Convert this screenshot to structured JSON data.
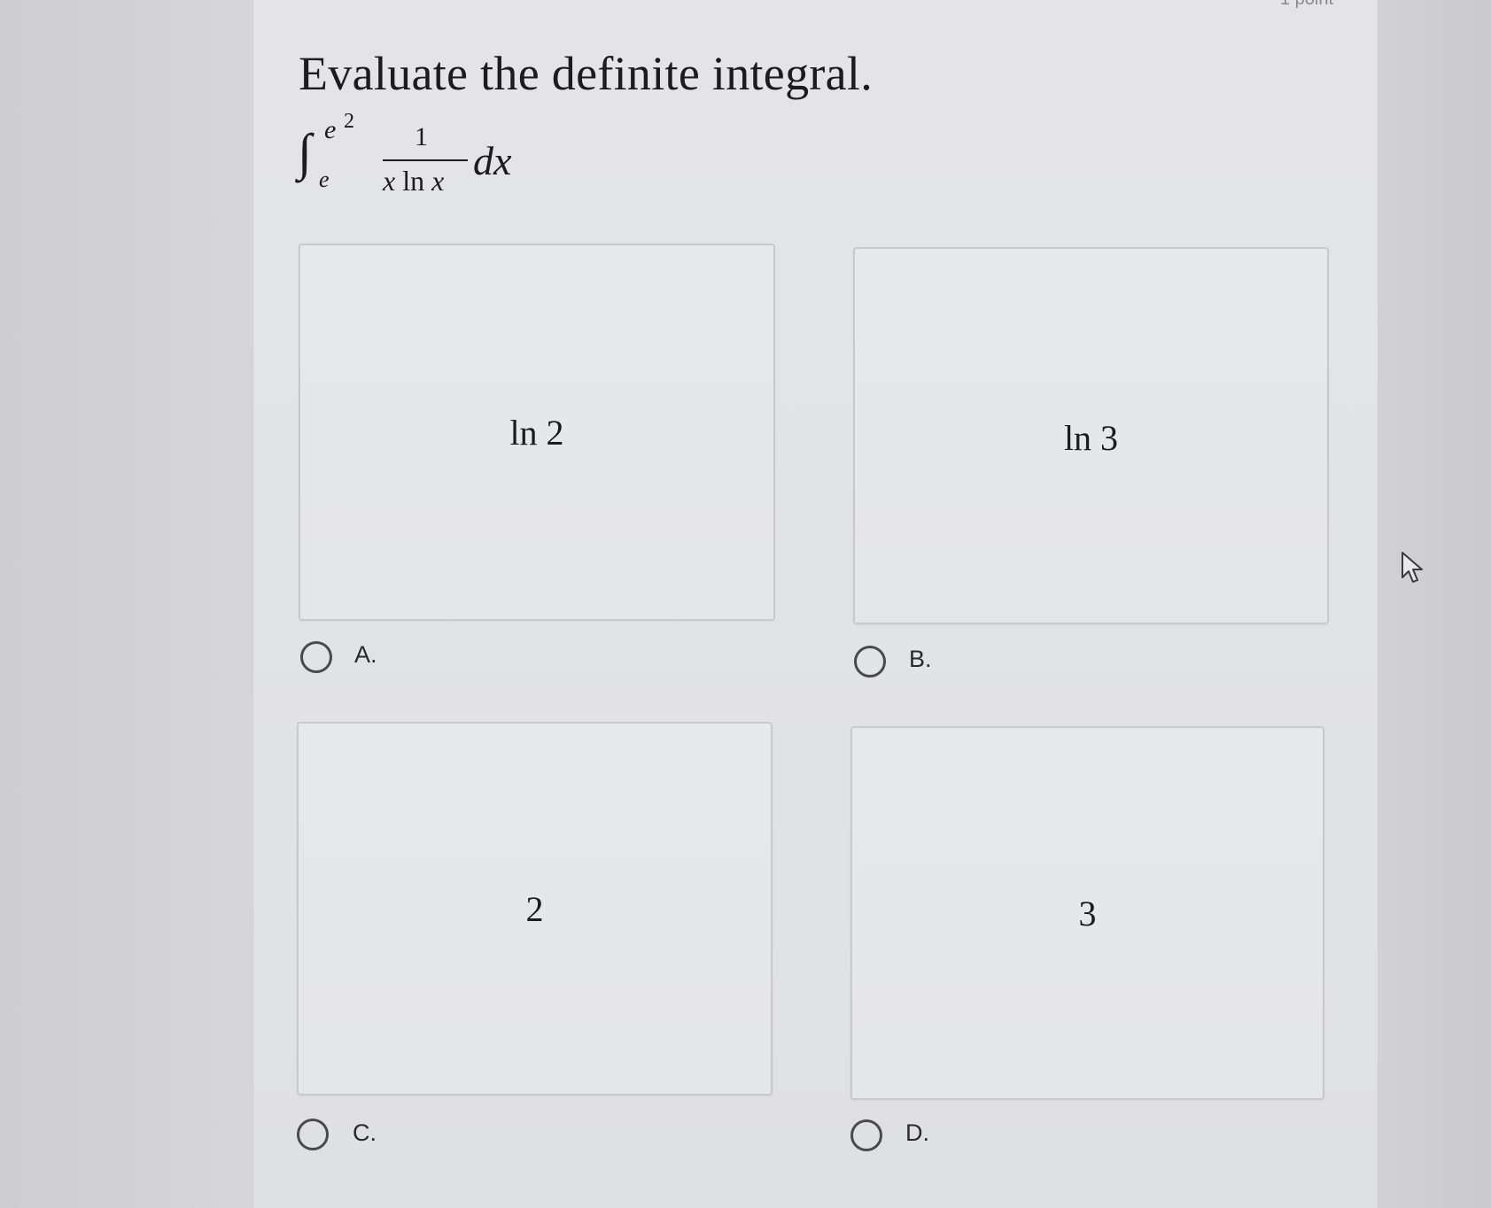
{
  "header": {
    "points_label": "1 point"
  },
  "question": {
    "title": "Evaluate the definite integral.",
    "integral": {
      "symbol": "∫",
      "upper_base": "e",
      "upper_exponent": "2",
      "lower": "e",
      "numerator": "1",
      "denominator_x1": "x",
      "denominator_ln": "ln",
      "denominator_x2": "x",
      "differential": "dx"
    }
  },
  "options": [
    {
      "letter": "A.",
      "value": "ln 2"
    },
    {
      "letter": "B.",
      "value": "ln 3"
    },
    {
      "letter": "C.",
      "value": "2"
    },
    {
      "letter": "D.",
      "value": "3"
    }
  ],
  "cursor": {
    "icon": "arrow-pointer-icon"
  }
}
